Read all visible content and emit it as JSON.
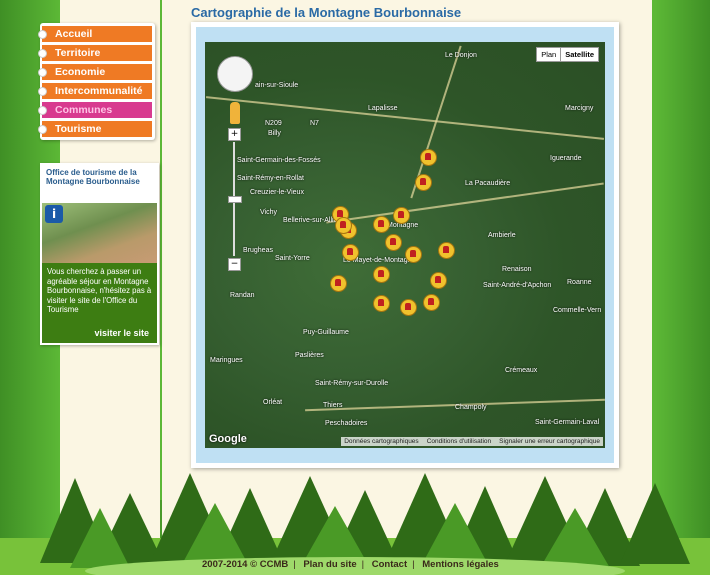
{
  "page": {
    "title": "Cartographie de la Montagne Bourbonnaise"
  },
  "menu": {
    "items": [
      {
        "label": "Accueil",
        "active": false
      },
      {
        "label": "Territoire",
        "active": false
      },
      {
        "label": "Economie",
        "active": false
      },
      {
        "label": "Intercommunalité",
        "active": false
      },
      {
        "label": "Communes",
        "active": true
      },
      {
        "label": "Tourisme",
        "active": false
      }
    ]
  },
  "tourism": {
    "heading": "Office de tourisme de la Montagne Bourbonnaise",
    "text": "Vous cherchez à passer un agréable séjour en Montagne Bourbonnaise, n'hésitez pas à visiter le site de l'Office du Tourisme",
    "link": "visiter le site"
  },
  "map": {
    "toggle": {
      "plan": "Plan",
      "satellite": "Satellite",
      "selected": "Satellite"
    },
    "zoom": {
      "in": "+",
      "out": "−"
    },
    "places": [
      {
        "name": "Le Donjon"
      },
      {
        "name": "ain-sur-Sioule"
      },
      {
        "name": "Lapalisse"
      },
      {
        "name": "Marcigny"
      },
      {
        "name": "N209"
      },
      {
        "name": "N7"
      },
      {
        "name": "Billy"
      },
      {
        "name": "Saint-Germain-des-Fossés"
      },
      {
        "name": "Saint-Rémy-en-Rollat"
      },
      {
        "name": "Creuzier-le-Vieux"
      },
      {
        "name": "Vichy"
      },
      {
        "name": "Bellerive-sur-Allier"
      },
      {
        "name": "Brugheas"
      },
      {
        "name": "Saint-Yorre"
      },
      {
        "name": "Randan"
      },
      {
        "name": "La Pacaudière"
      },
      {
        "name": "Iguerande"
      },
      {
        "name": "Ambierle"
      },
      {
        "name": "Renaison"
      },
      {
        "name": "Saint-André-d'Apchon"
      },
      {
        "name": "Roanne"
      },
      {
        "name": "Commelle-Vern"
      },
      {
        "name": "Puy-Guillaume"
      },
      {
        "name": "Maringues"
      },
      {
        "name": "Paslières"
      },
      {
        "name": "Crémeaux"
      },
      {
        "name": "Saint-Rémy-sur-Durolle"
      },
      {
        "name": "Thiers"
      },
      {
        "name": "Orléat"
      },
      {
        "name": "Champoly"
      },
      {
        "name": "Saint-Germain-Laval"
      },
      {
        "name": "Peschadoires"
      },
      {
        "name": "Le Mayet-de-Montagne"
      },
      {
        "name": "Montagne"
      }
    ],
    "attribution": {
      "data": "Données cartographiques",
      "terms": "Conditions d'utilisation",
      "report": "Signaler une erreur cartographique"
    },
    "logo": "Google",
    "marker_count": 17
  },
  "footer": {
    "year": "2007-2014",
    "copy": "© CCMB",
    "links": [
      "Plan du site",
      "Contact",
      "Mentions légales"
    ]
  }
}
